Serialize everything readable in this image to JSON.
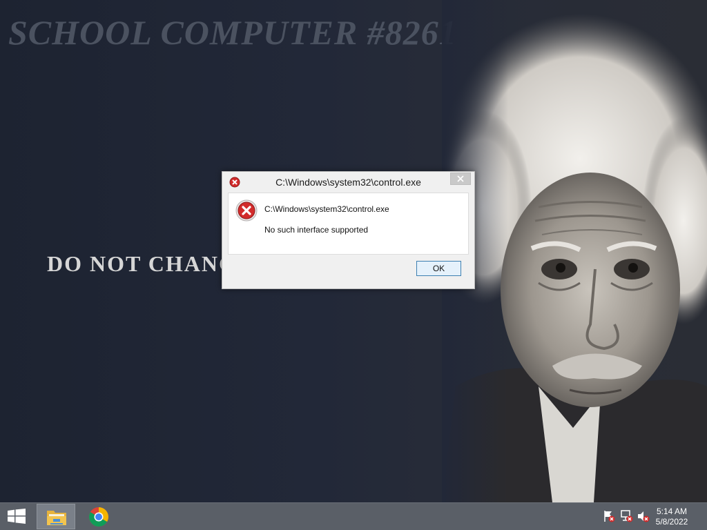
{
  "desktop": {
    "wallpaper_title": "SCHOOL COMPUTER #8261",
    "wallpaper_slogan": "DO NOT CHANGE"
  },
  "dialog": {
    "title": "C:\\Windows\\system32\\control.exe",
    "message_path": "C:\\Windows\\system32\\control.exe",
    "message": "No such interface supported",
    "ok_label": "OK",
    "icon": "error-icon",
    "close_icon": "close-icon"
  },
  "taskbar": {
    "start_icon": "windows-logo-icon",
    "pinned": [
      {
        "name": "file-explorer",
        "icon": "folder-icon",
        "active": true
      },
      {
        "name": "chrome",
        "icon": "chrome-icon",
        "active": false
      }
    ],
    "tray": [
      "action-center-flag-icon",
      "network-icon",
      "volume-muted-icon"
    ],
    "clock_time": "5:14 AM",
    "clock_date": "5/8/2022"
  },
  "colors": {
    "taskbar": "#5a5f67",
    "desktop": "#1e2432",
    "ok_button_border": "#3c7fb1",
    "error_red": "#d22b2b"
  }
}
